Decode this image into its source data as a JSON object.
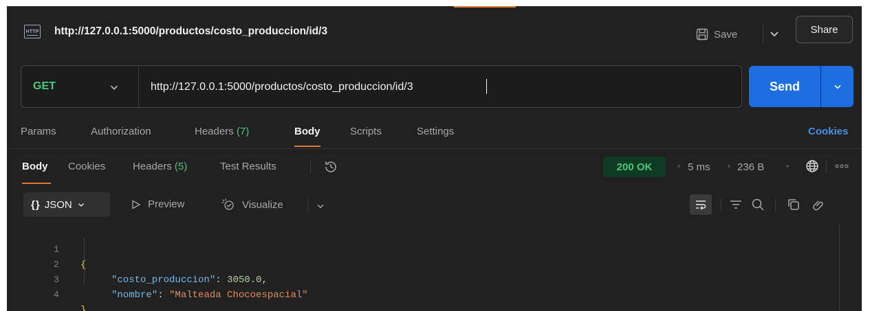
{
  "titlebar": {
    "protocol_icon_text": "HTTP",
    "title": "http://127.0.0.1:5000/productos/costo_produccion/id/3",
    "save_label": "Save",
    "share_label": "Share"
  },
  "request": {
    "method": "GET",
    "url": "http://127.0.0.1:5000/productos/costo_produccion/id/3",
    "send_label": "Send"
  },
  "request_tabs": [
    {
      "label": "Params",
      "count": ""
    },
    {
      "label": "Authorization",
      "count": ""
    },
    {
      "label": "Headers",
      "count": "(7)"
    },
    {
      "label": "Body",
      "count": "",
      "active": true
    },
    {
      "label": "Scripts",
      "count": ""
    },
    {
      "label": "Settings",
      "count": ""
    }
  ],
  "cookies_link": "Cookies",
  "response_tabs": [
    {
      "label": "Body",
      "count": "",
      "active": true
    },
    {
      "label": "Cookies",
      "count": ""
    },
    {
      "label": "Headers",
      "count": "(5)"
    },
    {
      "label": "Test Results",
      "count": ""
    }
  ],
  "response_meta": {
    "status": "200 OK",
    "time": "5 ms",
    "size": "236 B"
  },
  "body_toolbar": {
    "format_braces": "{}",
    "format_label": "JSON",
    "preview_label": "Preview",
    "visualize_label": "Visualize"
  },
  "response_body": {
    "line_numbers": [
      "1",
      "2",
      "3",
      "4"
    ],
    "open_brace": "{",
    "close_brace": "}",
    "key1": "\"costo_produccion\"",
    "value1": "3050.0",
    "key2": "\"nombre\"",
    "value2": "\"Malteada Chocoespacial\""
  },
  "colors": {
    "accent": "#e07a32",
    "send_button": "#1d6ee0",
    "method_get": "#49c983",
    "status_ok": "#4ec47d",
    "link": "#4a8fe8"
  },
  "icons": [
    "http-icon",
    "save-icon",
    "chevron-down-icon",
    "history-icon",
    "globe-icon",
    "more-icon",
    "play-icon",
    "visualize-icon",
    "wrap-icon",
    "filter-icon",
    "search-icon",
    "copy-icon",
    "link-icon"
  ]
}
